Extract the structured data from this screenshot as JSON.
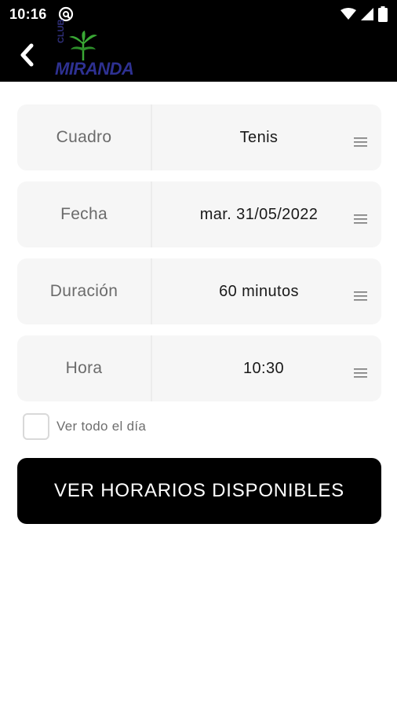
{
  "status_bar": {
    "time": "10:16"
  },
  "app_bar": {
    "logo_small_text": "CLUB",
    "logo_text": "MIRANDA",
    "brand_color": "#2e3192",
    "plant_color": "#3aa935"
  },
  "form": {
    "fields": [
      {
        "label": "Cuadro",
        "value": "Tenis"
      },
      {
        "label": "Fecha",
        "value": "mar. 31/05/2022"
      },
      {
        "label": "Duración",
        "value": "60 minutos"
      },
      {
        "label": "Hora",
        "value": "10:30"
      }
    ],
    "checkbox": {
      "label": "Ver todo el día",
      "checked": false
    }
  },
  "actions": {
    "primary_label": "VER HORARIOS DISPONIBLES"
  },
  "icons": {
    "back": "chevron-left-icon",
    "notification": "at-sign-icon",
    "wifi": "wifi-icon",
    "signal": "signal-icon",
    "battery": "battery-icon",
    "field_menu": "menu-icon"
  }
}
